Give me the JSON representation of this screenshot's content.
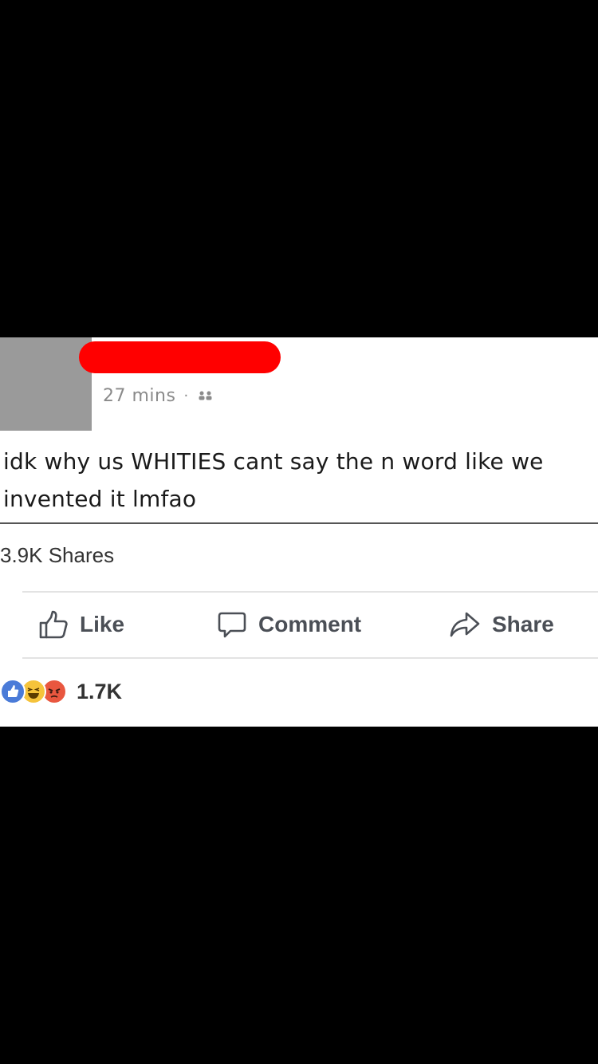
{
  "post": {
    "timestamp": "27 mins",
    "separator": "·",
    "audience_icon": "friends-icon",
    "text_line_1": "idk why us WHITIES cant say the n word like we",
    "text_line_2": "invented it lmfao",
    "shares": "3.9K Shares",
    "reaction_count": "1.7K",
    "reactions": [
      "like-reaction-icon",
      "haha-reaction-icon",
      "angry-reaction-icon"
    ]
  },
  "actions": {
    "like_label": "Like",
    "comment_label": "Comment",
    "share_label": "Share"
  },
  "colors": {
    "redaction": "#ff0000",
    "avatar_placeholder": "#9a9a9a",
    "like_blue": "#4a7bd8",
    "haha_yellow": "#f5c33b",
    "angry_red": "#e9573f"
  }
}
